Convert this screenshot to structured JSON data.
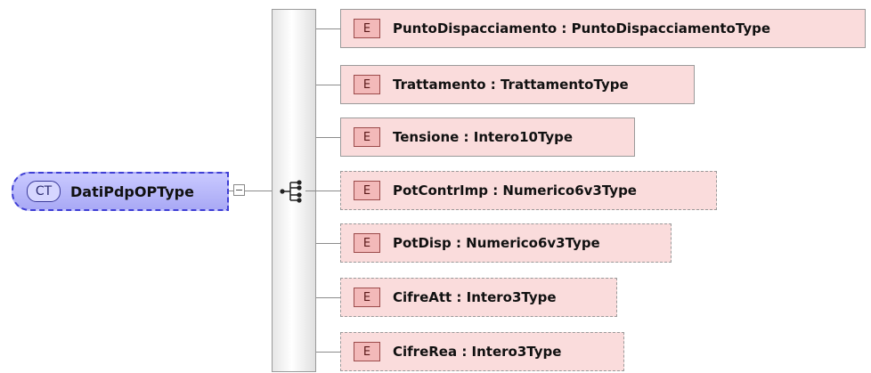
{
  "complex_type": {
    "badge": "CT",
    "name": "DatiPdpOPType"
  },
  "elements": [
    {
      "badge": "E",
      "label": "PuntoDispacciamento : PuntoDispacciamentoType",
      "optional": false
    },
    {
      "badge": "E",
      "label": "Trattamento : TrattamentoType",
      "optional": false
    },
    {
      "badge": "E",
      "label": "Tensione : Intero10Type",
      "optional": false
    },
    {
      "badge": "E",
      "label": "PotContrImp : Numerico6v3Type",
      "optional": true
    },
    {
      "badge": "E",
      "label": "PotDisp : Numerico6v3Type",
      "optional": true
    },
    {
      "badge": "E",
      "label": "CifreAtt : Intero3Type",
      "optional": true
    },
    {
      "badge": "E",
      "label": "CifreRea : Intero3Type",
      "optional": true
    }
  ]
}
